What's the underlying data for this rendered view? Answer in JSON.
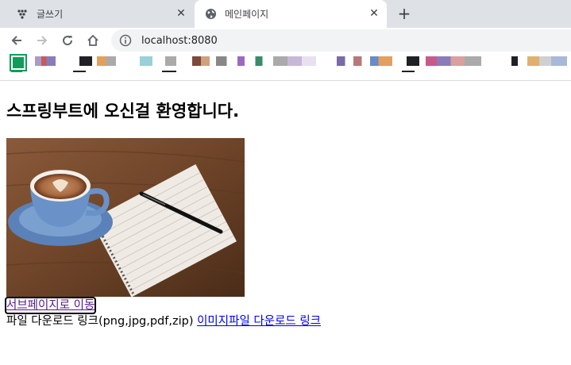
{
  "tabs": [
    {
      "title": "글쓰기",
      "icon": "app-dots-icon",
      "active": false
    },
    {
      "title": "메인페이지",
      "icon": "globe-icon",
      "active": true
    }
  ],
  "toolbar": {
    "url": "localhost:8080"
  },
  "page": {
    "heading": "스프링부트에 오신걸 환영합니다.",
    "image_alt": "커피와 노트",
    "sub_link": "서브페이지로 이동",
    "download_text": "파일 다운로드 링크(png,jpg,pdf,zip) ",
    "download_link": "이미지파일 다운로드 링크"
  },
  "colors": {
    "tabstrip": "#dee1e6",
    "visited_link": "#551a8b",
    "link": "#0000ee"
  }
}
